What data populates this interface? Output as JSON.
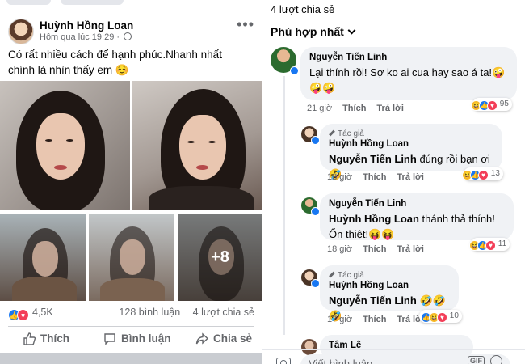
{
  "post": {
    "author": "Huỳnh Hồng Loan",
    "time": "Hôm qua lúc 19:29 ·",
    "text": "Có rất nhiều cách để hạnh phúc.Nhanh nhất chính là nhìn thấy em ☺️",
    "more_photos": "+8",
    "reaction_count": "4,5K",
    "comment_count": "128 bình luận",
    "share_count": "4 lượt chia sẻ",
    "actions": {
      "like": "Thích",
      "comment": "Bình luận",
      "share": "Chia sẻ"
    },
    "icons": [
      "globe-icon",
      "more-icon",
      "like-icon",
      "love-icon",
      "thumb-icon",
      "comment-icon",
      "share-icon"
    ]
  },
  "comments_panel": {
    "share_count": "4 lượt chia sẻ",
    "sort_label": "Phù hợp nhất",
    "comments": [
      {
        "author": "Nguyễn Tiến Linh",
        "author_tag": "",
        "mention": "",
        "text": "Lại thính rồi! Sợ ko ai cua hay sao á ta!🤪🤪🤪",
        "time": "21 giờ",
        "like": "Thích",
        "reply": "Trả lời",
        "reactions": "95"
      },
      {
        "author": "Huỳnh Hồng Loan",
        "author_tag": "Tác giả",
        "mention": "Nguyễn Tiến Linh",
        "text": " đúng rồi bạn ơi 🤣",
        "time": "18 giờ",
        "like": "Thích",
        "reply": "Trả lời",
        "reactions": "13"
      },
      {
        "author": "Nguyễn Tiến Linh",
        "author_tag": "",
        "mention": "Huỳnh Hồng Loan",
        "text": "  thánh thả thính! Ổn thiệt!😝😝",
        "time": "18 giờ",
        "like": "Thích",
        "reply": "Trả lời",
        "reactions": "11"
      },
      {
        "author": "Huỳnh Hồng Loan",
        "author_tag": "Tác giả",
        "mention": "Nguyễn Tiến Linh",
        "text": " 🤣🤣🤣",
        "time": "17 giờ",
        "like": "Thích",
        "reply": "Trả lời",
        "reactions": "10"
      },
      {
        "author": "Tâm Lê"
      }
    ],
    "write_placeholder": "Viết bình luận...",
    "gif_label": "GIF"
  },
  "colors": {
    "accent": "#1877f2",
    "love": "#f33e58",
    "haha": "#f7b928",
    "muted": "#65676b",
    "bubble": "#f0f2f5"
  }
}
